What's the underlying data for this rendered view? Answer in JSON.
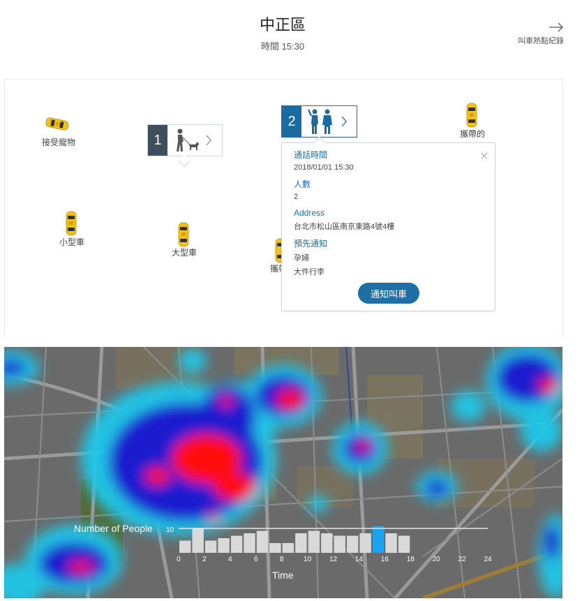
{
  "header": {
    "title": "中正區",
    "time_label": "時間 15:30",
    "hotspot_link_label": "叫車熱點紀錄",
    "hotspot_link_icon": "arrow-right-icon"
  },
  "taxis": [
    {
      "id": "pet",
      "label": "接受寵物",
      "icon": "taxi-icon"
    },
    {
      "id": "carry",
      "label": "攜帶的",
      "icon": "taxi-icon"
    },
    {
      "id": "small",
      "label": "小型車",
      "icon": "taxi-icon"
    },
    {
      "id": "large",
      "label": "大型車",
      "icon": "taxi-icon"
    },
    {
      "id": "carry2",
      "label": "攜帶",
      "icon": "taxi-icon"
    }
  ],
  "requests": [
    {
      "number": "1",
      "icon": "person-with-dog-icon"
    },
    {
      "number": "2",
      "icon": "two-people-icon"
    }
  ],
  "popup": {
    "call_time_label": "通話時間",
    "call_time_value": "2018/01/01 15:30",
    "people_label": "人數",
    "people_value": "2",
    "address_label": "Address",
    "address_value": "台北市松山區南京東路4號4樓",
    "notice_label": "預先通知",
    "notice_value_1": "孕婦",
    "notice_value_2": "大件行李",
    "notify_button": "通知叫車",
    "close_icon": "close-icon"
  },
  "colors": {
    "accent": "#1e6fa5",
    "taxi": "#f2c21b",
    "heat_high": "#ff0000",
    "heat_mid": "#2020d0",
    "heat_low": "#20c8e8",
    "bar": "#d9d9d9",
    "bar_current": "#1aa3ee"
  },
  "chart_data": {
    "type": "bar",
    "ylabel": "Number of People",
    "xlabel": "Time",
    "ytick": 10,
    "xticks": [
      0,
      2,
      4,
      6,
      8,
      10,
      12,
      14,
      16,
      18,
      20,
      22,
      24
    ],
    "xlim": [
      0,
      24
    ],
    "ylim": [
      0,
      10
    ],
    "values": [
      5,
      10,
      5,
      6,
      7,
      8,
      9,
      4,
      4,
      8,
      9,
      8,
      7,
      7,
      8,
      11,
      8,
      7
    ],
    "current_index": 15
  }
}
